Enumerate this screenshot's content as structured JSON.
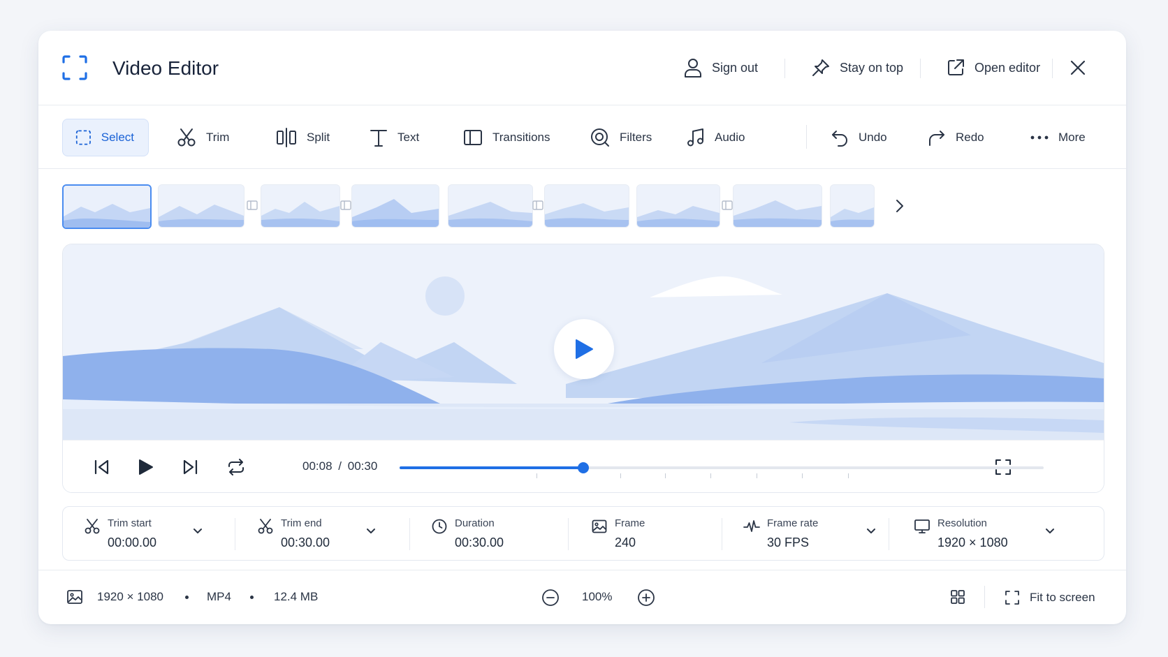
{
  "app": {
    "title": "Video Editor"
  },
  "titlebar": {
    "sign_out": "Sign out",
    "stay_on_top": "Stay on top",
    "open_editor": "Open editor"
  },
  "toolbar": {
    "select": "Select",
    "trim": "Trim",
    "split": "Split",
    "text": "Text",
    "transitions": "Transitions",
    "filters": "Filters",
    "audio": "Audio",
    "undo": "Undo",
    "redo": "Redo",
    "more": "More"
  },
  "player": {
    "current_time": "00:08",
    "separator": "/",
    "total_time": "00:30",
    "progress": 0.285
  },
  "properties": {
    "trim_start": {
      "label": "Trim start",
      "value": "00:00.00"
    },
    "trim_end": {
      "label": "Trim end",
      "value": "00:30.00"
    },
    "duration": {
      "label": "Duration",
      "value": "00:30.00"
    },
    "frame": {
      "label": "Frame",
      "value": "240"
    },
    "frame_rate": {
      "label": "Frame rate",
      "value": "30 FPS"
    },
    "resolution": {
      "label": "Resolution",
      "value": "1920 × 1080"
    }
  },
  "status": {
    "resolution": "1920 × 1080",
    "format": "MP4",
    "size": "12.4 MB",
    "zoom": "100%",
    "fit_to_screen": "Fit to screen"
  },
  "colors": {
    "accent": "#1f6fe5",
    "scene_light": "#e9f0fb",
    "mountain": "#9fbdf0"
  }
}
